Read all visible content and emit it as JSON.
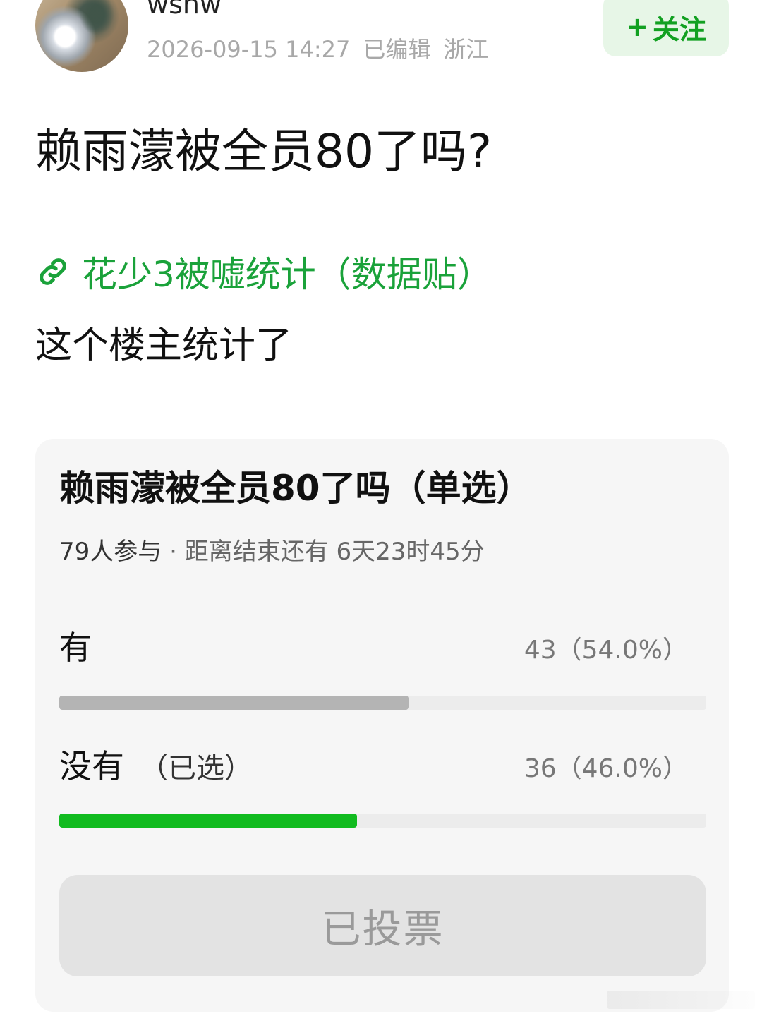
{
  "header": {
    "username": "wshw",
    "timestamp": "2026-09-15 14:27",
    "edited": "已编辑",
    "location": "浙江",
    "follow_label": "关注",
    "follow_plus": "+"
  },
  "post": {
    "title": "赖雨濛被全员80了吗?",
    "link_text": "花少3被嘘统计（数据贴）",
    "body": "这个楼主统计了"
  },
  "poll": {
    "title": "赖雨濛被全员80了吗（单选）",
    "participants": "79人参与",
    "separator": " · ",
    "remaining": "距离结束还有 6天23时45分",
    "options": [
      {
        "label": "有",
        "count": "43（54.0%）",
        "fraction": 0.54,
        "selected": false,
        "color": "#b4b4b4"
      },
      {
        "label": "没有",
        "selected_tag": "（已选）",
        "count": "36（46.0%）",
        "fraction": 0.46,
        "selected": true,
        "color": "#11bb1f"
      }
    ],
    "vote_button_label": "已投票"
  },
  "colors": {
    "accent_green": "#12a021",
    "selected_bar": "#11bb1f",
    "unselected_bar": "#b4b4b4"
  }
}
